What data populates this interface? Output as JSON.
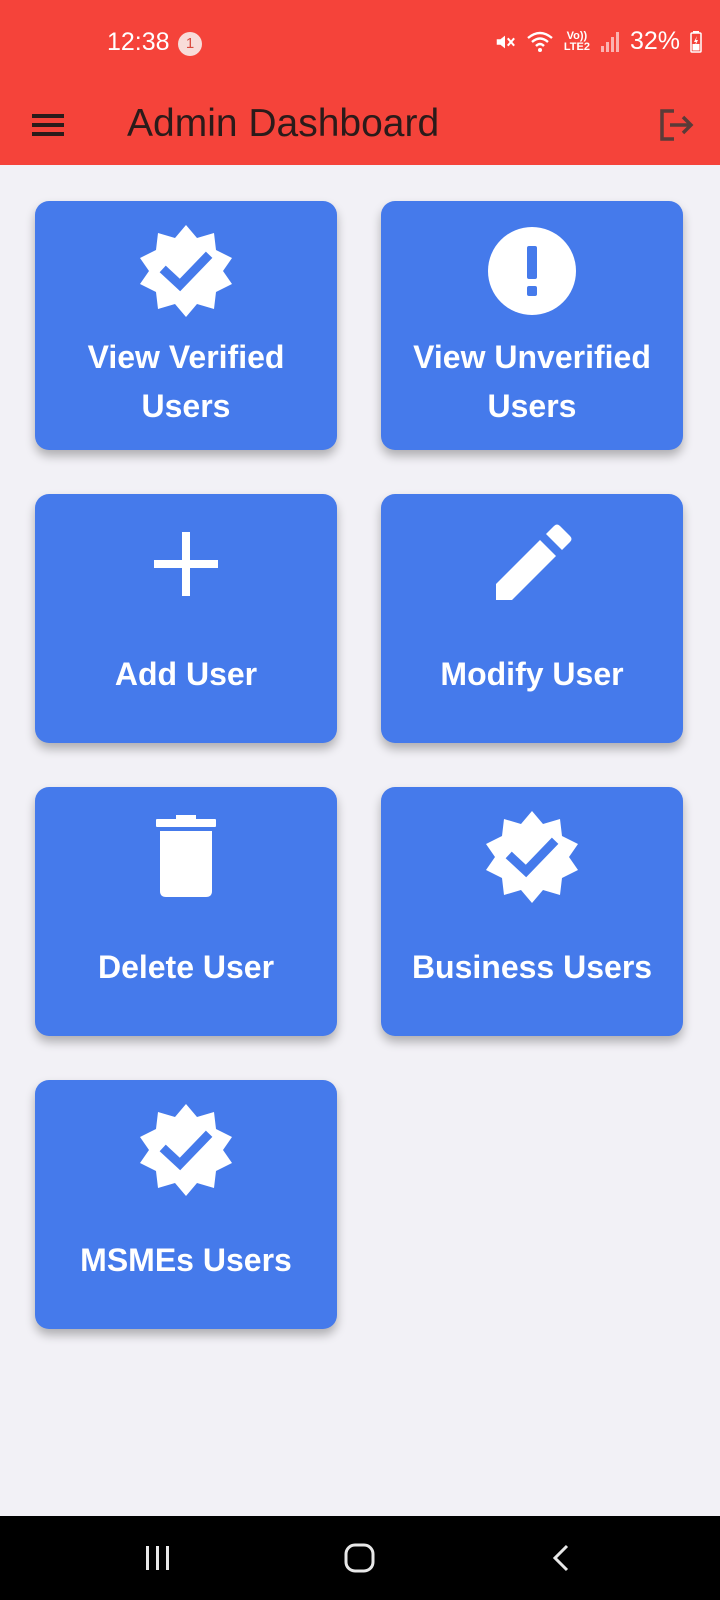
{
  "status_bar": {
    "time": "12:38",
    "notification_count": "1",
    "volte_top": "Vo))",
    "volte_bottom": "LTE2",
    "battery": "32%"
  },
  "app_bar": {
    "title": "Admin Dashboard",
    "menu_icon": "menu-icon",
    "logout_icon": "logout-icon"
  },
  "tiles": [
    {
      "label_line1": "View Verified",
      "label_line2": "Users",
      "icon": "verified-badge-icon"
    },
    {
      "label_line1": "View Unverified",
      "label_line2": "Users",
      "icon": "exclamation-circle-icon"
    },
    {
      "label": "Add User",
      "icon": "plus-icon"
    },
    {
      "label": "Modify User",
      "icon": "pencil-icon"
    },
    {
      "label": "Delete User",
      "icon": "trash-icon"
    },
    {
      "label": "Business Users",
      "icon": "verified-badge-icon"
    },
    {
      "label": "MSMEs Users",
      "icon": "verified-badge-icon"
    }
  ],
  "colors": {
    "app_bar": "#f5433a",
    "tile": "#457aeb",
    "background": "#f2f1f6",
    "nav_bar": "#000000"
  },
  "nav_bar": {
    "recents_icon": "recents-icon",
    "home_icon": "home-icon",
    "back_icon": "back-icon"
  }
}
